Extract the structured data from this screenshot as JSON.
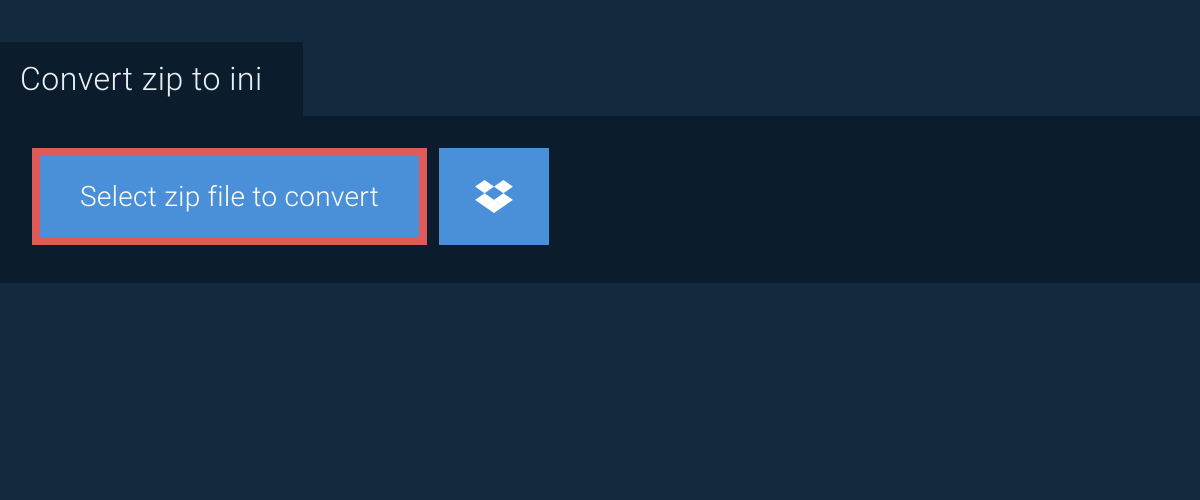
{
  "header": {
    "title": "Convert zip to ini"
  },
  "actions": {
    "select_label": "Select zip file to convert",
    "cloud_provider": "dropbox"
  },
  "colors": {
    "page_bg": "#13293d",
    "panel_bg": "#0b1c2c",
    "button_bg": "#4a90d9",
    "highlight_border": "#e05a5a",
    "text_light": "#e8eef3",
    "text_white": "#ffffff"
  }
}
